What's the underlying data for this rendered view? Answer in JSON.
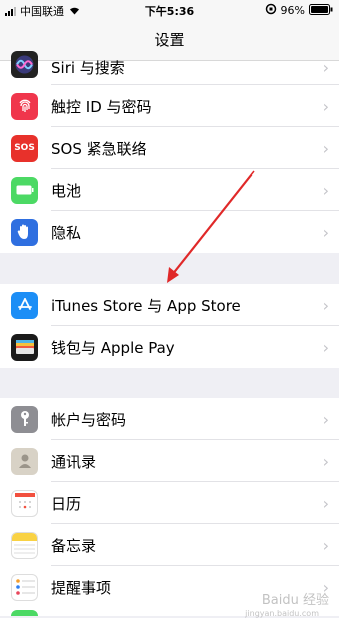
{
  "status": {
    "carrier": "中国联通",
    "time": "下午5:36",
    "battery": "96%"
  },
  "nav": {
    "title": "设置"
  },
  "colors": {
    "accent_arrow": "#e02828"
  },
  "group1": [
    {
      "label": "Siri 与搜索",
      "icon": "siri-icon"
    },
    {
      "label": "触控 ID 与密码",
      "icon": "fingerprint-icon"
    },
    {
      "label": "SOS 紧急联络",
      "icon": "sos-icon",
      "icon_text": "SOS"
    },
    {
      "label": "电池",
      "icon": "battery-icon"
    },
    {
      "label": "隐私",
      "icon": "hand-icon"
    }
  ],
  "group2": [
    {
      "label": "iTunes Store 与 App Store",
      "icon": "app-store-icon"
    },
    {
      "label": "钱包与 Apple Pay",
      "icon": "wallet-icon"
    }
  ],
  "group3": [
    {
      "label": "帐户与密码",
      "icon": "key-icon"
    },
    {
      "label": "通讯录",
      "icon": "contacts-icon"
    },
    {
      "label": "日历",
      "icon": "calendar-icon"
    },
    {
      "label": "备忘录",
      "icon": "notes-icon"
    },
    {
      "label": "提醒事项",
      "icon": "reminders-icon"
    }
  ],
  "watermark": {
    "text": "Baidu 经验",
    "sub": "jingyan.baidu.com"
  }
}
